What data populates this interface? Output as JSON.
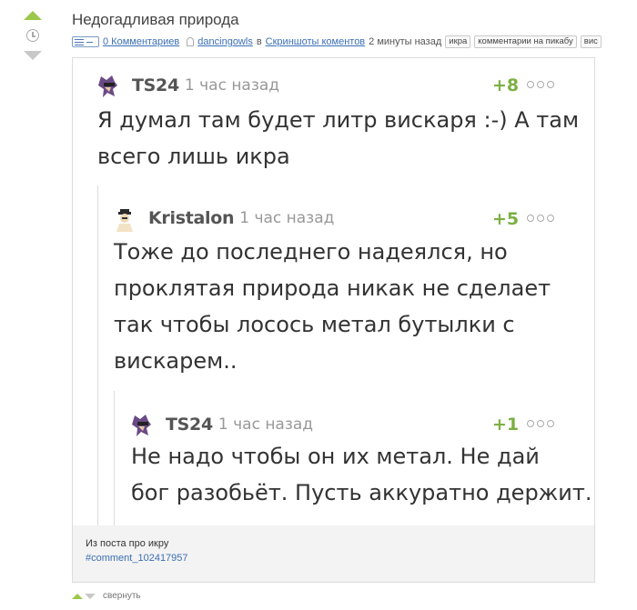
{
  "post": {
    "title": "Недогадливая природа",
    "comments_link": "0 Комментариев",
    "author": "dancingowls",
    "in_word": "в",
    "community": "Скриншоты коментов",
    "time": "2 минуты назад",
    "tags": [
      "икра",
      "комментарии на пикабу",
      "вис"
    ]
  },
  "comments": [
    {
      "user": "TS24",
      "time": "1 час назад",
      "rating": "+8",
      "line1": "Я думал там будет литр вискаря :-) А там",
      "line2": "всего лишь икра"
    },
    {
      "user": "Kristalon",
      "time": "1 час назад",
      "rating": "+5",
      "line1": "Тоже до последнего надеялся, но",
      "line2": "проклятая природа никак не сделает",
      "line3": "так чтобы лосось метал бутылки с",
      "line4": "вискарем.."
    },
    {
      "user": "TS24",
      "time": "1 час назад",
      "rating": "+1",
      "line1": "Не надо чтобы он их метал. Не дай",
      "line2": "бог разобьёт. Пусть аккуратно держит."
    }
  ],
  "card_footer": {
    "text": "Из поста про икру",
    "link": "#comment_102417957"
  },
  "bottom": {
    "collapse_label": "свернуть"
  },
  "colors": {
    "rating_green": "#7bb043",
    "link_blue": "#3b6fb6",
    "vote_up_green": "#9bc84a"
  }
}
